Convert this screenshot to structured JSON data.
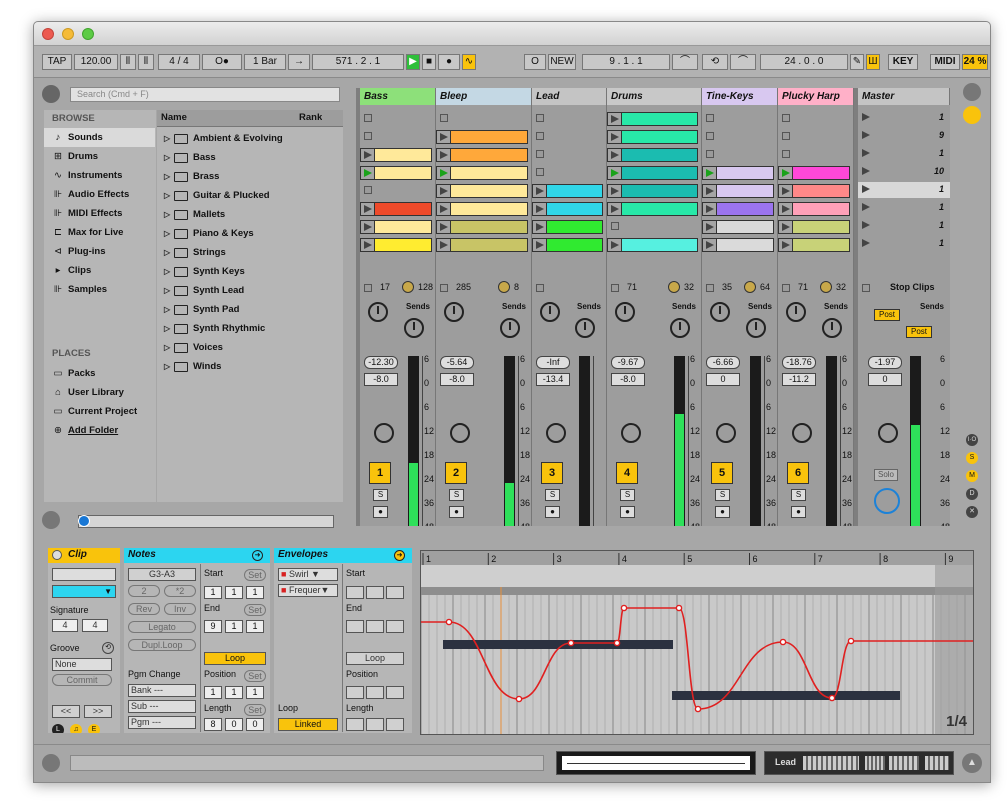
{
  "toolbar": {
    "tap": "TAP",
    "tempo": "120.00",
    "sig": "4 / 4",
    "metro": "O●",
    "quant": "1 Bar",
    "arr_pos": "571 .  2 .  1",
    "o_btn": "O",
    "new_btn": "NEW",
    "punch_in": "9 .  1 .  1",
    "loop_len": "24 .  0 .  0",
    "key": "KEY",
    "midi": "MIDI",
    "cpu": "24 %"
  },
  "browser": {
    "search_placeholder": "Search (Cmd + F)",
    "browse_label": "BROWSE",
    "places_label": "PLACES",
    "col_name": "Name",
    "col_rank": "Rank",
    "categories": [
      {
        "label": "Sounds",
        "icon": "♪"
      },
      {
        "label": "Drums",
        "icon": "⊞"
      },
      {
        "label": "Instruments",
        "icon": "∿"
      },
      {
        "label": "Audio Effects",
        "icon": "⊪"
      },
      {
        "label": "MIDI Effects",
        "icon": "⊪"
      },
      {
        "label": "Max for Live",
        "icon": "⊏"
      },
      {
        "label": "Plug-ins",
        "icon": "⊲"
      },
      {
        "label": "Clips",
        "icon": "▸"
      },
      {
        "label": "Samples",
        "icon": "⊪"
      }
    ],
    "places": [
      {
        "label": "Packs",
        "icon": "▭"
      },
      {
        "label": "User Library",
        "icon": "⌂"
      },
      {
        "label": "Current Project",
        "icon": "▭"
      },
      {
        "label": "Add Folder",
        "icon": "⊕"
      }
    ],
    "folders": [
      "Ambient & Evolving",
      "Bass",
      "Brass",
      "Guitar & Plucked",
      "Mallets",
      "Piano & Keys",
      "Strings",
      "Synth Keys",
      "Synth Lead",
      "Synth Pad",
      "Synth Rhythmic",
      "Voices",
      "Winds"
    ]
  },
  "session": {
    "tracks": [
      {
        "name": "Bass",
        "color": "#8de07a",
        "clips": [
          "",
          "",
          "#ffe99a",
          "#ffe99a",
          "",
          "#ef4a2a",
          "#ffe99a",
          "#ffec30"
        ],
        "playing": 3,
        "vol": "17",
        "pan": "128",
        "level": "-12.30",
        "send": "-8.0",
        "num": "1",
        "meter": 0.38
      },
      {
        "name": "Bleep",
        "color": "#c4d8e4",
        "clips": [
          "",
          "#ffa83a",
          "#ffa83a",
          "#ffe99a",
          "#ffe99a",
          "#ffe99a",
          "#c8c466",
          "#c8c466"
        ],
        "playing": 3,
        "vol": "285",
        "pan": "8",
        "level": "-5.64",
        "send": "-8.0",
        "num": "2",
        "meter": 0.26
      },
      {
        "name": "Lead",
        "color": "#c4c4c4",
        "clips": [
          "",
          "",
          "",
          "",
          "#30d6e8",
          "#30d6e8",
          "#30ea30",
          "#30ea30"
        ],
        "playing": -1,
        "vol": "",
        "pan": "",
        "level": "-Inf",
        "send": "-13.4",
        "num": "3",
        "meter": 0
      },
      {
        "name": "Drums",
        "color": "#c8c8c8",
        "clips": [
          "#28e8a8",
          "#28e8a8",
          "#1bbcb0",
          "#1bbcb0",
          "#1bbcb0",
          "#28e8a8",
          "",
          "#56f0e0"
        ],
        "playing": 3,
        "vol": "71",
        "pan": "32",
        "level": "-9.67",
        "send": "-8.0",
        "num": "4",
        "meter": 0.66
      },
      {
        "name": "Tine-Keys",
        "color": "#d8c8f0",
        "clips": [
          "",
          "",
          "",
          "#d8c8f0",
          "#d8c8f0",
          "#9b74ee",
          "#dadada",
          "#dadada"
        ],
        "playing": 3,
        "vol": "35",
        "pan": "64",
        "level": "-6.66",
        "send": "0",
        "num": "5",
        "meter": 0
      },
      {
        "name": "Plucky Harp",
        "color": "#ffb0c8",
        "clips": [
          "",
          "",
          "",
          "#ff48d8",
          "#ff8888",
          "#ffa0b8",
          "#c8d278",
          "#c8d278"
        ],
        "playing": 3,
        "vol": "71",
        "pan": "32",
        "level": "-18.76",
        "send": "-11.2",
        "num": "6",
        "meter": 0
      }
    ],
    "master": {
      "name": "Master",
      "scenes": [
        "1",
        "9",
        "1",
        "10",
        "1",
        "1",
        "1",
        "1"
      ],
      "stop_clips": "Stop Clips",
      "level": "-1.97",
      "send": "0",
      "solo": "Solo",
      "post": "Post"
    },
    "sends": "Sends",
    "db_marks": [
      "6",
      "0",
      "6",
      "12",
      "18",
      "24",
      "36",
      "48"
    ],
    "stop_label": "S"
  },
  "clip": {
    "title": "Clip",
    "signature": "Signature",
    "sig_num": "4",
    "sig_den": "4",
    "groove": "Groove",
    "groove_val": "None",
    "commit": "Commit"
  },
  "notes": {
    "title": "Notes",
    "range": "G3-A3",
    "start": "Start",
    "set": "Set",
    "end": "End",
    "half": "2",
    "double": "*2",
    "rev": "Rev",
    "inv": "Inv",
    "legato": "Legato",
    "dupl": "Dupl.Loop",
    "loop": "Loop",
    "pgm": "Pgm Change",
    "bank": "Bank ---",
    "sub": "Sub ---",
    "pgm_val": "Pgm ---",
    "position": "Position",
    "length": "Length",
    "start_v": [
      "1",
      "1",
      "1"
    ],
    "end_v": [
      "9",
      "1",
      "1"
    ],
    "pos_v": [
      "1",
      "1",
      "1"
    ],
    "len_v": [
      "8",
      "0",
      "0"
    ]
  },
  "envelopes": {
    "title": "Envelopes",
    "dev": "Swirl",
    "param": "Frequer",
    "start": "Start",
    "end": "End",
    "loop": "Loop",
    "position": "Position",
    "length": "Length",
    "linked": "Linked"
  },
  "editor": {
    "bars": [
      "1",
      "2",
      "3",
      "4",
      "5",
      "6",
      "7",
      "8",
      "9"
    ],
    "zoom": "1/4"
  },
  "status": {
    "track": "Lead"
  }
}
